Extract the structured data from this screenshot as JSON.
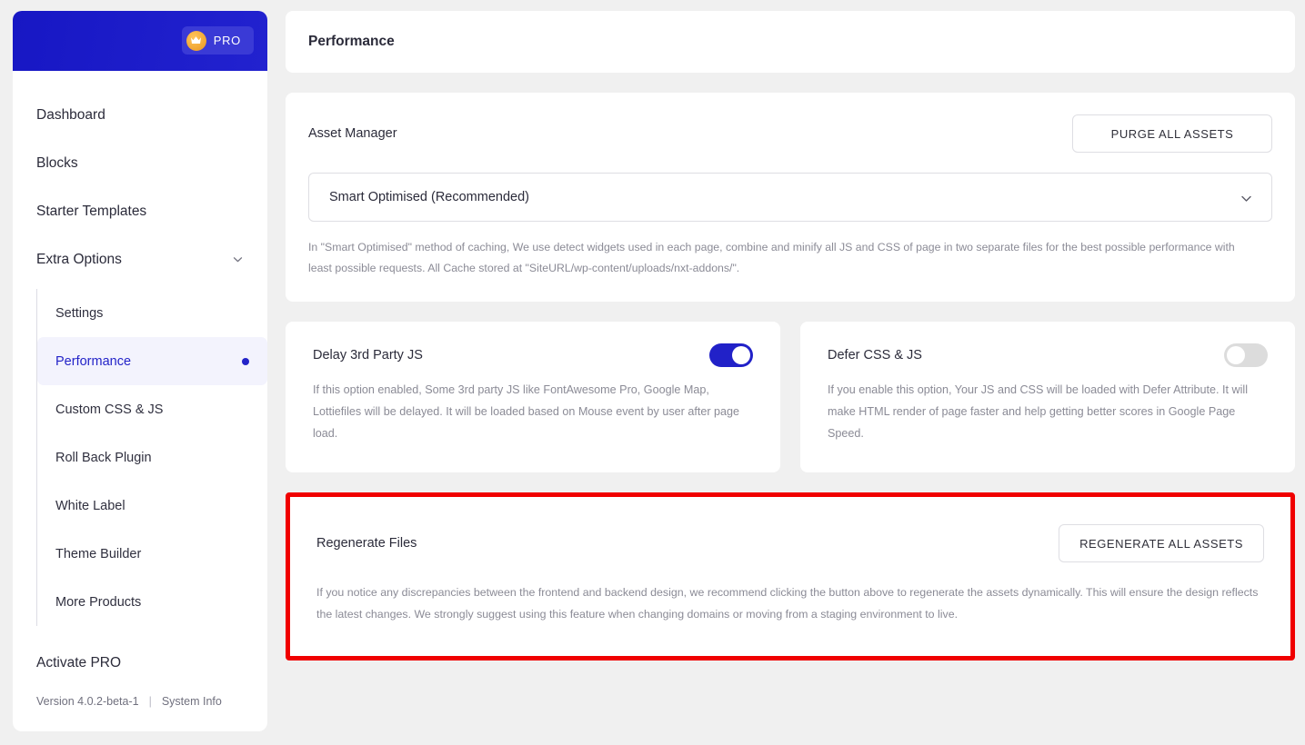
{
  "sidebar": {
    "pro_badge": {
      "label": "PRO",
      "icon": "crown-icon",
      "bg": "#3a3ad6",
      "crown_color": "#f0a430"
    },
    "header_bg": "#1d1dc9",
    "nav": [
      {
        "label": "Dashboard"
      },
      {
        "label": "Blocks"
      },
      {
        "label": "Starter Templates"
      }
    ],
    "group": {
      "label": "Extra Options",
      "icon": "chevron-down-icon",
      "expanded": true,
      "items": [
        {
          "label": "Settings",
          "active": false
        },
        {
          "label": "Performance",
          "active": true
        },
        {
          "label": "Custom CSS & JS",
          "active": false
        },
        {
          "label": "Roll Back Plugin",
          "active": false
        },
        {
          "label": "White Label",
          "active": false
        },
        {
          "label": "Theme Builder",
          "active": false
        },
        {
          "label": "More Products",
          "active": false
        }
      ]
    },
    "activate_pro": "Activate PRO",
    "version": "Version 4.0.2-beta-1",
    "separator": "|",
    "system_info": "System Info",
    "active_color": "#2323c8"
  },
  "main": {
    "page_title": "Performance",
    "asset_manager": {
      "label": "Asset Manager",
      "purge_button": "PURGE ALL ASSETS",
      "select_value": "Smart Optimised (Recommended)",
      "select_icon": "chevron-down-icon",
      "description": "In \"Smart Optimised\" method of caching, We use detect widgets used in each page, combine and minify all JS and CSS of page in two separate files for the best possible performance with least possible requests. All Cache stored at \"SiteURL/wp-content/uploads/nxt-addons/\"."
    },
    "toggles": [
      {
        "label": "Delay 3rd Party JS",
        "state": "on",
        "description": "If this option enabled, Some 3rd party JS like FontAwesome Pro, Google Map, Lottiefiles will be delayed. It will be loaded based on Mouse event by user after page load."
      },
      {
        "label": "Defer CSS & JS",
        "state": "off",
        "description": "If you enable this option, Your JS and CSS will be loaded with Defer Attribute. It will make HTML render of page faster and help getting better scores in Google Page Speed."
      }
    ],
    "regenerate": {
      "label": "Regenerate Files",
      "button": "REGENERATE ALL ASSETS",
      "description": "If you notice any discrepancies between the frontend and backend design, we recommend clicking the button above to regenerate the assets dynamically. This will ensure the design reflects the latest changes. We strongly suggest using this feature when changing domains or moving from a staging environment to live.",
      "highlight_color": "#f00000"
    }
  }
}
